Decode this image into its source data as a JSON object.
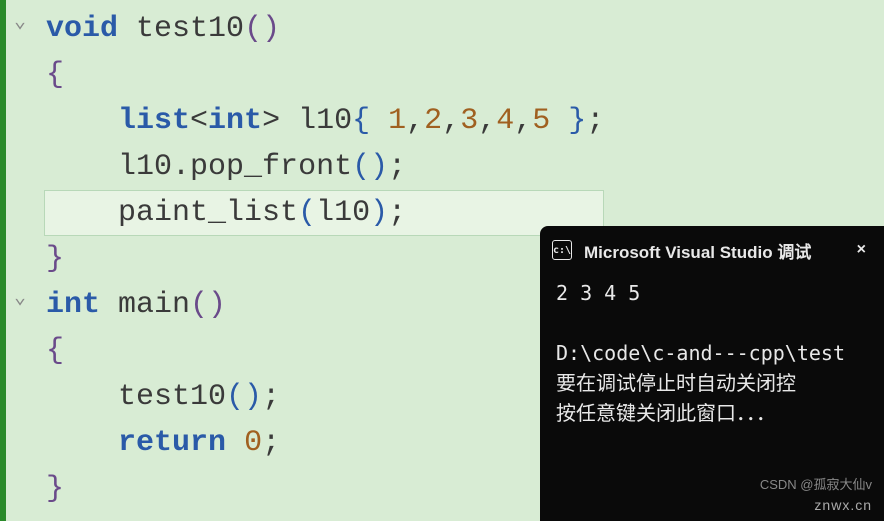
{
  "code": {
    "lines": [
      {
        "fold": "v",
        "tokens": [
          [
            "kw",
            "void"
          ],
          [
            "",
            ""
          ],
          [
            "id",
            "test10"
          ],
          [
            "par",
            "()"
          ]
        ]
      },
      {
        "tokens": [
          [
            "par",
            "{"
          ]
        ]
      },
      {
        "tokens": [
          [
            "",
            "    "
          ],
          [
            "ty",
            "list"
          ],
          [
            "pn",
            "<"
          ],
          [
            "kw",
            "int"
          ],
          [
            "pn",
            ">"
          ],
          [
            "",
            ""
          ],
          [
            "id",
            "l10"
          ],
          [
            "par2",
            "{"
          ],
          [
            "",
            ""
          ],
          [
            "num",
            "1"
          ],
          [
            "pn",
            ","
          ],
          [
            "num",
            "2"
          ],
          [
            "pn",
            ","
          ],
          [
            "num",
            "3"
          ],
          [
            "pn",
            ","
          ],
          [
            "num",
            "4"
          ],
          [
            "pn",
            ","
          ],
          [
            "num",
            "5"
          ],
          [
            "",
            ""
          ],
          [
            "par2",
            "}"
          ],
          [
            "pn",
            ";"
          ]
        ]
      },
      {
        "tokens": [
          [
            "",
            "    "
          ],
          [
            "id",
            "l10"
          ],
          [
            "pn",
            "."
          ],
          [
            "id",
            "pop_front"
          ],
          [
            "par2",
            "()"
          ],
          [
            "pn",
            ";"
          ]
        ]
      },
      {
        "highlight": true,
        "tokens": [
          [
            "",
            "    "
          ],
          [
            "id",
            "paint_list"
          ],
          [
            "par2",
            "("
          ],
          [
            "id",
            "l10"
          ],
          [
            "par2",
            ")"
          ],
          [
            "pn",
            ";"
          ]
        ]
      },
      {
        "tokens": [
          [
            "par",
            "}"
          ]
        ]
      },
      {
        "fold": "v",
        "tokens": [
          [
            "kw",
            "int"
          ],
          [
            "",
            ""
          ],
          [
            "id",
            "main"
          ],
          [
            "par",
            "()"
          ]
        ]
      },
      {
        "tokens": [
          [
            "par",
            "{"
          ]
        ]
      },
      {
        "tokens": [
          [
            "",
            "    "
          ],
          [
            "id",
            "test10"
          ],
          [
            "par2",
            "()"
          ],
          [
            "pn",
            ";"
          ]
        ]
      },
      {
        "tokens": [
          [
            "",
            "    "
          ],
          [
            "kw",
            "return"
          ],
          [
            "",
            ""
          ],
          [
            "num",
            "0"
          ],
          [
            "pn",
            ";"
          ]
        ]
      },
      {
        "tokens": [
          [
            "par",
            "}"
          ]
        ]
      }
    ]
  },
  "console": {
    "title": "Microsoft Visual Studio 调试",
    "close": "×",
    "output": "2 3 4 5",
    "path": "D:\\code\\c-and---cpp\\test",
    "msg1": "要在调试停止时自动关闭控",
    "msg2": "按任意键关闭此窗口．．．"
  },
  "watermark": {
    "top": "CSDN @孤寂大仙v",
    "main": "znwx.cn"
  }
}
